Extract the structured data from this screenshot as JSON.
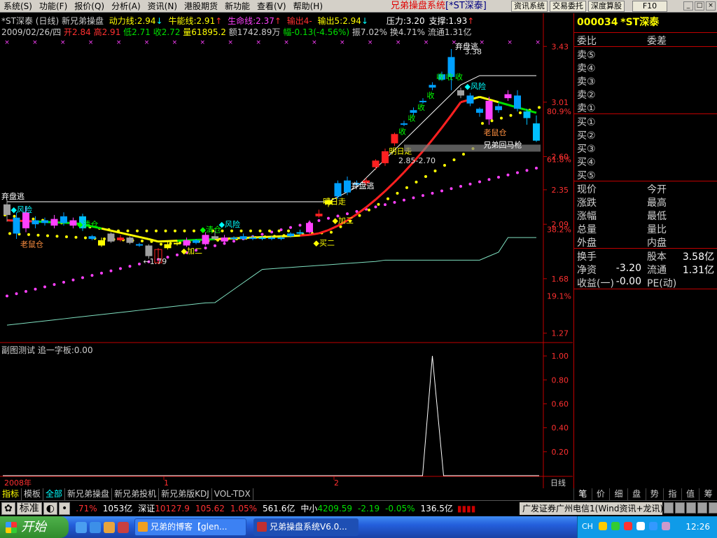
{
  "menu": [
    "系统(S)",
    "功能(F)",
    "报价(Q)",
    "分析(A)",
    "资讯(N)",
    "港股期货",
    "新功能",
    "查看(V)",
    "帮助(H)"
  ],
  "app_title": "兄弟操盘系统",
  "app_stock": "[*ST深泰]",
  "toolbar": [
    "资讯系统",
    "交易委托",
    "深度算股",
    "F10"
  ],
  "window_controls": [
    "_",
    "□",
    "×"
  ],
  "header": {
    "stock_line": "*ST深泰 (日线) 新兄弟操盘",
    "dong": "动力线:2.94",
    "dong_arrow": "↓",
    "niu": "牛能线:2.91",
    "niu_arrow": "↑",
    "sheng": "生命线:2.37",
    "sheng_arrow": "↑",
    "out4": "输出4-",
    "out5": "输出5:2.94",
    "out5_arrow": "↓",
    "pressure": "压力:3.20",
    "support": "支撑:1.93",
    "support_arrow": "↑"
  },
  "quote_line": {
    "date": "2009/02/26/四",
    "open": "开2.84",
    "high": "高2.91",
    "low": "低2.71",
    "close": "收2.72",
    "vol": "量61895.2",
    "amount": "额1742.89万",
    "change": "幅-0.13(-4.56%)",
    "amp": "振7.02%",
    "turnover": "换4.71%",
    "float": "流通1.31亿"
  },
  "sub_chart": {
    "title": "副图测试 追一字板:0.00"
  },
  "chart_data": [
    {
      "type": "candlestick",
      "title": "",
      "price_ticks": [
        3.43,
        3.01,
        2.6,
        2.35,
        2.09,
        1.68,
        1.27
      ],
      "fib_labels": [
        "80.9%",
        "61.8%",
        "38.2%",
        "19.1%"
      ],
      "fib_values": [
        2.94,
        2.58,
        2.05,
        1.55
      ],
      "ylim": [
        1.22,
        3.5
      ],
      "x_labels": [
        "2008年",
        "1",
        "2"
      ],
      "candles": [
        {
          "o": 2.16,
          "c": 2.24,
          "h": 2.28,
          "l": 2.11,
          "k": "g"
        },
        {
          "o": 2.14,
          "c": 2.02,
          "h": 2.18,
          "l": 1.98,
          "k": "b"
        },
        {
          "o": 2.06,
          "c": 2.18,
          "h": 2.22,
          "l": 2.03,
          "k": "m"
        },
        {
          "o": 2.12,
          "c": 2.09,
          "h": 2.15,
          "l": 2.06,
          "k": "b"
        },
        {
          "o": 2.1,
          "c": 2.12,
          "h": 2.14,
          "l": 2.08,
          "k": "b"
        },
        {
          "o": 2.08,
          "c": 2.13,
          "h": 2.16,
          "l": 2.06,
          "k": "m"
        },
        {
          "o": 2.1,
          "c": 2.15,
          "h": 2.18,
          "l": 2.08,
          "k": "b"
        },
        {
          "o": 2.08,
          "c": 2.12,
          "h": 2.14,
          "l": 2.06,
          "k": "m"
        },
        {
          "o": 2.15,
          "c": 2.06,
          "h": 2.17,
          "l": 2.04,
          "k": "c"
        },
        {
          "o": 2.0,
          "c": 1.98,
          "h": 2.01,
          "l": 1.97,
          "k": "b"
        },
        {
          "o": 1.97,
          "c": 1.93,
          "h": 1.99,
          "l": 1.92,
          "k": "y"
        },
        {
          "o": 2.02,
          "c": 1.96,
          "h": 2.03,
          "l": 1.95,
          "k": "g"
        },
        {
          "o": 1.97,
          "c": 1.99,
          "h": 2.01,
          "l": 1.96,
          "k": "r"
        },
        {
          "o": 1.99,
          "c": 1.95,
          "h": 2.0,
          "l": 1.94,
          "k": "g"
        },
        {
          "o": 1.94,
          "c": 1.93,
          "h": 1.95,
          "l": 1.92,
          "k": "b"
        },
        {
          "o": 1.93,
          "c": 1.85,
          "h": 1.94,
          "l": 1.83,
          "k": "g"
        },
        {
          "o": 1.8,
          "c": 1.9,
          "h": 1.91,
          "l": 1.79,
          "k": "ro"
        },
        {
          "o": 1.91,
          "c": 1.94,
          "h": 1.96,
          "l": 1.9,
          "k": "y"
        },
        {
          "o": 1.94,
          "c": 1.95,
          "h": 1.97,
          "l": 1.93,
          "k": "y"
        },
        {
          "o": 1.93,
          "c": 1.97,
          "h": 1.99,
          "l": 1.92,
          "k": "m"
        },
        {
          "o": 1.97,
          "c": 1.95,
          "h": 1.98,
          "l": 1.94,
          "k": "b"
        },
        {
          "o": 1.94,
          "c": 2.01,
          "h": 2.03,
          "l": 1.93,
          "k": "m"
        },
        {
          "o": 2.0,
          "c": 1.98,
          "h": 2.04,
          "l": 1.97,
          "k": "g"
        },
        {
          "o": 1.96,
          "c": 1.99,
          "h": 2.01,
          "l": 1.95,
          "k": "m"
        },
        {
          "o": 1.99,
          "c": 1.98,
          "h": 2.0,
          "l": 1.97,
          "k": "b"
        },
        {
          "o": 1.98,
          "c": 2.0,
          "h": 2.02,
          "l": 1.97,
          "k": "b"
        },
        {
          "o": 1.99,
          "c": 1.98,
          "h": 2.01,
          "l": 1.97,
          "k": "b"
        },
        {
          "o": 1.98,
          "c": 1.99,
          "h": 2.0,
          "l": 1.97,
          "k": "c"
        },
        {
          "o": 1.99,
          "c": 1.98,
          "h": 2.0,
          "l": 1.97,
          "k": "b"
        },
        {
          "o": 1.99,
          "c": 1.98,
          "h": 2.0,
          "l": 1.97,
          "k": "b"
        },
        {
          "o": 2.0,
          "c": 2.02,
          "h": 2.03,
          "l": 1.99,
          "k": "b"
        },
        {
          "o": 2.02,
          "c": 2.03,
          "h": 2.05,
          "l": 2.01,
          "k": "c"
        },
        {
          "o": 2.03,
          "c": 2.1,
          "h": 2.12,
          "l": 2.02,
          "k": "m"
        },
        {
          "o": 2.15,
          "c": 2.17,
          "h": 2.2,
          "l": 2.14,
          "k": "r"
        },
        {
          "o": 2.24,
          "c": 2.27,
          "h": 2.29,
          "l": 2.22,
          "k": "y"
        },
        {
          "o": 2.3,
          "c": 2.4,
          "h": 2.42,
          "l": 2.28,
          "k": "b"
        },
        {
          "o": 2.33,
          "c": 2.42,
          "h": 2.45,
          "l": 2.31,
          "k": "b"
        },
        {
          "o": 2.4,
          "c": 2.4,
          "h": 2.42,
          "l": 2.38,
          "k": "b"
        },
        {
          "o": 2.4,
          "c": 2.42,
          "h": 2.44,
          "l": 2.38,
          "k": "r"
        },
        {
          "o": 2.52,
          "c": 2.57,
          "h": 2.58,
          "l": 2.5,
          "k": "r"
        },
        {
          "o": 2.55,
          "c": 2.64,
          "h": 2.66,
          "l": 2.53,
          "k": "r"
        },
        {
          "o": 2.7,
          "c": 2.77,
          "h": 2.78,
          "l": 2.68,
          "k": "r"
        },
        {
          "o": 2.85,
          "c": 2.85,
          "h": 2.87,
          "l": 2.83,
          "k": "b"
        },
        {
          "o": 2.93,
          "c": 2.95,
          "h": 2.97,
          "l": 2.91,
          "k": "b"
        },
        {
          "o": 3.02,
          "c": 3.02,
          "h": 3.04,
          "l": 3.0,
          "k": "b"
        },
        {
          "o": 3.12,
          "c": 3.14,
          "h": 3.16,
          "l": 3.1,
          "k": "b"
        },
        {
          "o": 3.18,
          "c": 3.22,
          "h": 3.24,
          "l": 3.17,
          "k": "b"
        },
        {
          "o": 3.2,
          "c": 3.35,
          "h": 3.41,
          "l": 3.1,
          "k": "b"
        },
        {
          "o": 3.1,
          "c": 3.06,
          "h": 3.12,
          "l": 3.04,
          "k": "g"
        },
        {
          "o": 3.06,
          "c": 3.0,
          "h": 3.08,
          "l": 2.98,
          "k": "b"
        },
        {
          "o": 2.96,
          "c": 2.93,
          "h": 2.97,
          "l": 2.9,
          "k": "b"
        },
        {
          "o": 2.88,
          "c": 3.02,
          "h": 3.05,
          "l": 2.84,
          "k": "m"
        },
        {
          "o": 2.95,
          "c": 2.98,
          "h": 3.0,
          "l": 2.93,
          "k": "b"
        },
        {
          "o": 3.04,
          "c": 3.07,
          "h": 3.1,
          "l": 3.02,
          "k": "m"
        },
        {
          "o": 3.06,
          "c": 2.96,
          "h": 3.1,
          "l": 2.94,
          "k": "b"
        },
        {
          "o": 2.94,
          "c": 2.89,
          "h": 2.96,
          "l": 2.84,
          "k": "c"
        },
        {
          "o": 2.85,
          "c": 2.72,
          "h": 2.91,
          "l": 2.71,
          "k": "c"
        }
      ],
      "annotations": [
        {
          "text": "弃盘逃",
          "x": 0,
          "y": 2.28
        },
        {
          "text": "◆风险",
          "x": 1,
          "y": 2.18
        },
        {
          "text": "老鼠仓",
          "x": 2,
          "y": 1.92
        },
        {
          "text": "◆清仓",
          "x": 8,
          "y": 2.07
        },
        {
          "text": "←1.79",
          "x": 15,
          "y": 1.79
        },
        {
          "text": "◆加二",
          "x": 19,
          "y": 1.87
        },
        {
          "text": "◆清仓",
          "x": 21,
          "y": 2.03
        },
        {
          "text": "◆风险",
          "x": 23,
          "y": 2.07
        },
        {
          "text": "明日走",
          "x": 34,
          "y": 2.24
        },
        {
          "text": "◆加三",
          "x": 35,
          "y": 2.1
        },
        {
          "text": "◆买二",
          "x": 33,
          "y": 1.93
        },
        {
          "text": "弃盘逃",
          "x": 37,
          "y": 2.36
        },
        {
          "text": "明日走",
          "x": 41,
          "y": 2.62
        },
        {
          "text": "2.85-2.70",
          "x": 42,
          "y": 2.55
        },
        {
          "text": "收",
          "x": 42,
          "y": 2.77
        },
        {
          "text": "收",
          "x": 43,
          "y": 2.87
        },
        {
          "text": "收",
          "x": 44,
          "y": 2.95
        },
        {
          "text": "收",
          "x": 45,
          "y": 3.04
        },
        {
          "text": "收",
          "x": 46,
          "y": 3.18
        },
        {
          "text": "收",
          "x": 47,
          "y": 3.18
        },
        {
          "text": "收",
          "x": 48,
          "y": 3.18
        },
        {
          "text": "弃盘逃",
          "x": 48,
          "y": 3.41
        },
        {
          "text": "3.38",
          "x": 49,
          "y": 3.37
        },
        {
          "text": "◆风险",
          "x": 49,
          "y": 3.11
        },
        {
          "text": "老鼠仓",
          "x": 51,
          "y": 2.76
        },
        {
          "text": "兄弟回马枪",
          "x": 51,
          "y": 2.67
        }
      ],
      "sub_chart": {
        "ticks": [
          1.0,
          0.8,
          0.6,
          0.4,
          0.2
        ],
        "ylim": [
          0,
          1.1
        ],
        "spike_index": 45,
        "spike_value": 1.0
      }
    }
  ],
  "axis_label_day": "日线",
  "quote_panel": {
    "code": "000034",
    "name": "*ST深泰",
    "webi": "委比",
    "wecha": "委差",
    "sell": [
      "卖⑤",
      "卖④",
      "卖③",
      "卖②",
      "卖①"
    ],
    "buy": [
      "买①",
      "买②",
      "买③",
      "买④",
      "买⑤"
    ],
    "stats": [
      {
        "a": "现价",
        "b": "今开"
      },
      {
        "a": "涨跌",
        "b": "最高"
      },
      {
        "a": "涨幅",
        "b": "最低"
      },
      {
        "a": "总量",
        "b": "量比"
      },
      {
        "a": "外盘",
        "b": "内盘"
      }
    ],
    "fin": [
      {
        "a": "换手",
        "av": "",
        "b": "股本",
        "bv": "3.58亿"
      },
      {
        "a": "净资",
        "av": "-3.20",
        "b": "流通",
        "bv": "1.31亿"
      },
      {
        "a": "收益(一)",
        "av": "-0.00",
        "b": "PE(动)",
        "bv": ""
      }
    ]
  },
  "quote_tabs": [
    "笔",
    "价",
    "细",
    "盘",
    "势",
    "指",
    "值",
    "筹"
  ],
  "bottom_tabs": [
    "指标",
    "模板",
    "全部",
    "新兄弟操盘",
    "新兄弟投机",
    "新兄弟版KDJ",
    "VOL-TDX"
  ],
  "ticker": {
    "btn_std": "标准",
    "p1": ".71%",
    "p2": "1053亿",
    "sz_label": "深证",
    "sz": "10127.9",
    "sz_ch": "105.62",
    "sz_pct": "1.05%",
    "sz_amt": "561.6亿",
    "zx_label": "中小",
    "zx": "4209.59",
    "zx_ch": "-2.19",
    "zx_pct": "-0.05%",
    "zx_amt": "136.5亿",
    "broker": "广发证券广州电信1(Wind资讯+龙讯)"
  },
  "taskbar": {
    "start": "开始",
    "tasks": [
      "兄弟的博客【glen...",
      "兄弟操盘系统V6.0..."
    ],
    "lang": "CH",
    "clock": "12:26"
  }
}
